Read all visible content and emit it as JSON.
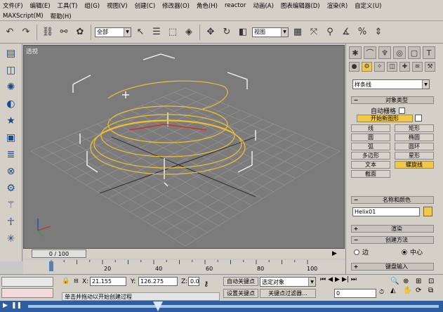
{
  "menu": {
    "items": [
      "文件(F)",
      "编辑(E)",
      "工具(T)",
      "组(G)",
      "视图(V)",
      "创建(C)",
      "修改器(O)",
      "角色(H)",
      "reactor",
      "动画(A)",
      "图表编辑器(D)",
      "渲染(R)",
      "自定义(U)"
    ],
    "items2": [
      "MAXScript(M)",
      "帮助(H)"
    ]
  },
  "toolbar": {
    "selection_filter": "全部",
    "ref_coord": "视图"
  },
  "viewport": {
    "label": "透视"
  },
  "timeline": {
    "slider_text": "0 / 100",
    "ticks": [
      "20",
      "40",
      "60",
      "80",
      "100"
    ]
  },
  "command_panel": {
    "category": "样条线",
    "object_type_title": "对象类型",
    "auto_grid": "自动栅格",
    "start_new_shape": "开始新图形",
    "buttons": [
      {
        "label": "线",
        "active": false
      },
      {
        "label": "矩形",
        "active": false
      },
      {
        "label": "圆",
        "active": false
      },
      {
        "label": "椭圆",
        "active": false
      },
      {
        "label": "弧",
        "active": false
      },
      {
        "label": "圆环",
        "active": false
      },
      {
        "label": "多边形",
        "active": false
      },
      {
        "label": "星形",
        "active": false
      },
      {
        "label": "文本",
        "active": false
      },
      {
        "label": "螺旋线",
        "active": true
      },
      {
        "label": "截面",
        "active": false
      }
    ],
    "name_color_title": "名称和颜色",
    "object_name": "Helix01",
    "object_color": "#f2c84a",
    "rendering_title": "渲染",
    "creation_method_title": "创建方法",
    "radio_edge": "边",
    "radio_center": "中心",
    "keyboard_entry_title": "键盘输入"
  },
  "status": {
    "x_label": "X:",
    "x_value": "21.155",
    "y_label": "Y:",
    "y_value": "126.275",
    "z_label": "Z:",
    "z_value": "0.0",
    "auto_key": "自动关键点",
    "selected_label": "选定对象",
    "set_key": "设置关键点",
    "key_filters": "关键点过滤器...",
    "frame_value": "0",
    "prompt": "单击并拖动以开始创建过程"
  },
  "colors": {
    "viewport_bg": "#7b7b7b",
    "helix": "#f0c030",
    "active_button": "#f2c84a",
    "playbar": "#2f5ea0"
  }
}
